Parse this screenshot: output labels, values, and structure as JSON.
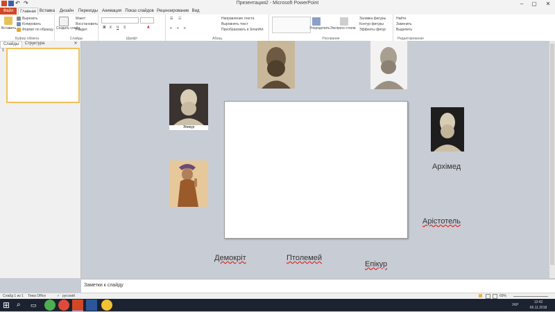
{
  "window": {
    "title": "Презентация2 - Microsoft PowerPoint"
  },
  "tabs": [
    "Файл",
    "Главная",
    "Вставка",
    "Дизайн",
    "Переходы",
    "Анимация",
    "Показ слайдов",
    "Рецензирование",
    "Вид"
  ],
  "ribbon": {
    "clipboard": {
      "paste": "Вставить",
      "cut": "Вырезать",
      "copy": "Копировать",
      "format": "Формат по образцу",
      "label": "Буфер обмена"
    },
    "slides": {
      "new_slide": "Создать слайд",
      "layout": "Макет",
      "reset": "Восстановить",
      "section": "Раздел",
      "label": "Слайды"
    },
    "font": {
      "label": "Шрифт"
    },
    "paragraph": {
      "direction": "Направление текста",
      "align": "Выровнять текст",
      "smartart": "Преобразовать в SmartArt",
      "label": "Абзац"
    },
    "drawing": {
      "arrange": "Упорядочить",
      "quick_styles": "Экспресс-стили",
      "fill": "Заливка фигуры",
      "outline": "Контур фигуры",
      "effects": "Эффекты фигур",
      "label": "Рисование"
    },
    "editing": {
      "find": "Найти",
      "replace": "Заменить",
      "select": "Выделить",
      "label": "Редактирование"
    }
  },
  "pane": {
    "tab_slides": "Слайды",
    "tab_outline": "Структура",
    "slide_number": "1"
  },
  "slide": {
    "caption_epicurus": "Эпикур",
    "labels": {
      "archimedes": "Архімед",
      "aristotle": "Арістотель",
      "democritus": "Демокріт",
      "ptolemy": "Птолемей",
      "epicurus": "Епікур"
    }
  },
  "notes": {
    "placeholder": "Заметки к слайду"
  },
  "status": {
    "slide": "Слайд 1 из 1",
    "theme": "Тема Office",
    "lang": "русский",
    "zoom": "69%"
  },
  "taskbar": {
    "lang": "УКР",
    "time": "12:42",
    "date": "06.11.2018"
  },
  "colors": {
    "file_tab": "#d24726",
    "taskbar": "#1c2230",
    "canvas": "#c8ccd4"
  }
}
